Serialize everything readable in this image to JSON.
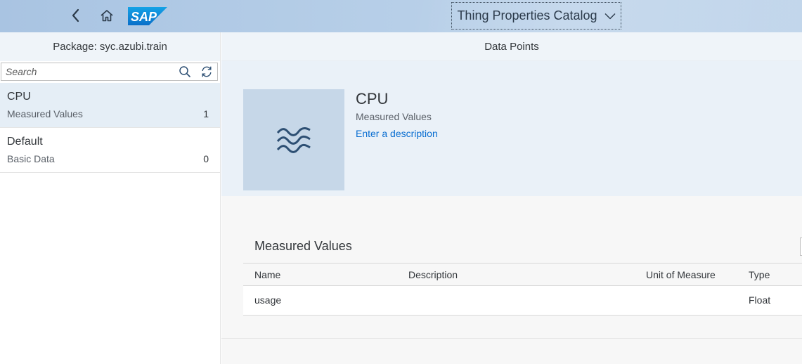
{
  "shell": {
    "title": "Thing Properties Catalog",
    "logo_text": "SAP",
    "icons": {
      "back": "chevron-left-icon",
      "home": "home-icon",
      "title_dropdown": "chevron-down-icon"
    }
  },
  "master": {
    "header": "Package: syc.azubi.train",
    "search_placeholder": "Search",
    "search_value": "",
    "items": [
      {
        "title": "CPU",
        "description": "Measured Values",
        "count": "1",
        "selected": true
      },
      {
        "title": "Default",
        "description": "Basic Data",
        "count": "0",
        "selected": false
      }
    ]
  },
  "detail": {
    "header": "Data Points",
    "object": {
      "title": "CPU",
      "subtitle": "Measured Values",
      "description_link": "Enter a description"
    },
    "section": {
      "title": "Measured Values",
      "columns": [
        "Name",
        "Description",
        "Unit of Measure",
        "Type"
      ],
      "rows": [
        {
          "name": "usage",
          "description": "",
          "unit": "",
          "type": "Float"
        }
      ]
    }
  },
  "colors": {
    "shell_bg": "#a9c4e2",
    "link": "#0a6ed1",
    "selected_item": "#e5eef6",
    "object_image_bg": "#c6d7e8",
    "icon_dark": "#2d4f73"
  }
}
